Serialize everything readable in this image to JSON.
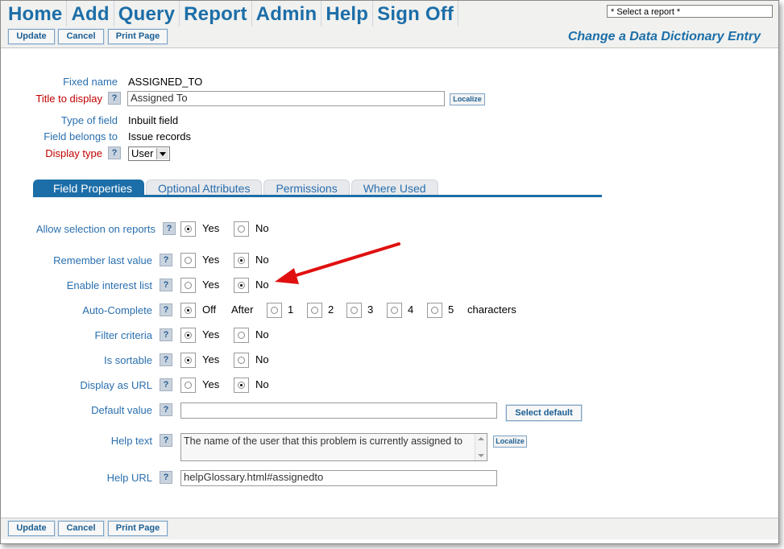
{
  "menu": {
    "items": [
      "Home",
      "Add",
      "Query",
      "Report",
      "Admin",
      "Help",
      "Sign Off"
    ],
    "report_select": "* Select a report *"
  },
  "toolbar": {
    "update": "Update",
    "cancel": "Cancel",
    "print": "Print Page",
    "page_title": "Change a Data Dictionary Entry"
  },
  "header_fields": {
    "fixed_name_label": "Fixed name",
    "fixed_name_value": "ASSIGNED_TO",
    "title_label": "Title to display",
    "title_value": "Assigned To",
    "localize": "Localize",
    "type_label": "Type of field",
    "type_value": "Inbuilt field",
    "belongs_label": "Field belongs to",
    "belongs_value": "Issue records",
    "display_type_label": "Display type",
    "display_type_value": "User"
  },
  "tabs": [
    "Field Properties",
    "Optional Attributes",
    "Permissions",
    "Where Used"
  ],
  "props": {
    "help_glyph": "?",
    "yes": "Yes",
    "no": "No",
    "allow_selection": "Allow selection on reports",
    "remember_last": "Remember last value",
    "enable_interest": "Enable interest list",
    "auto_complete": "Auto-Complete",
    "off": "Off",
    "after": "After",
    "n1": "1",
    "n2": "2",
    "n3": "3",
    "n4": "4",
    "n5": "5",
    "characters": "characters",
    "filter_criteria": "Filter criteria",
    "is_sortable": "Is sortable",
    "display_url": "Display as URL",
    "default_value": "Default value",
    "select_default": "Select default",
    "help_text_label": "Help text",
    "help_text_value": "The name of the user that this problem is currently assigned to",
    "help_url_label": "Help URL",
    "help_url_value": "helpGlossary.html#assignedto"
  },
  "colors": {
    "brand": "#1c6ea8",
    "required_label": "#c00000",
    "annotation_arrow": "#e01010"
  }
}
